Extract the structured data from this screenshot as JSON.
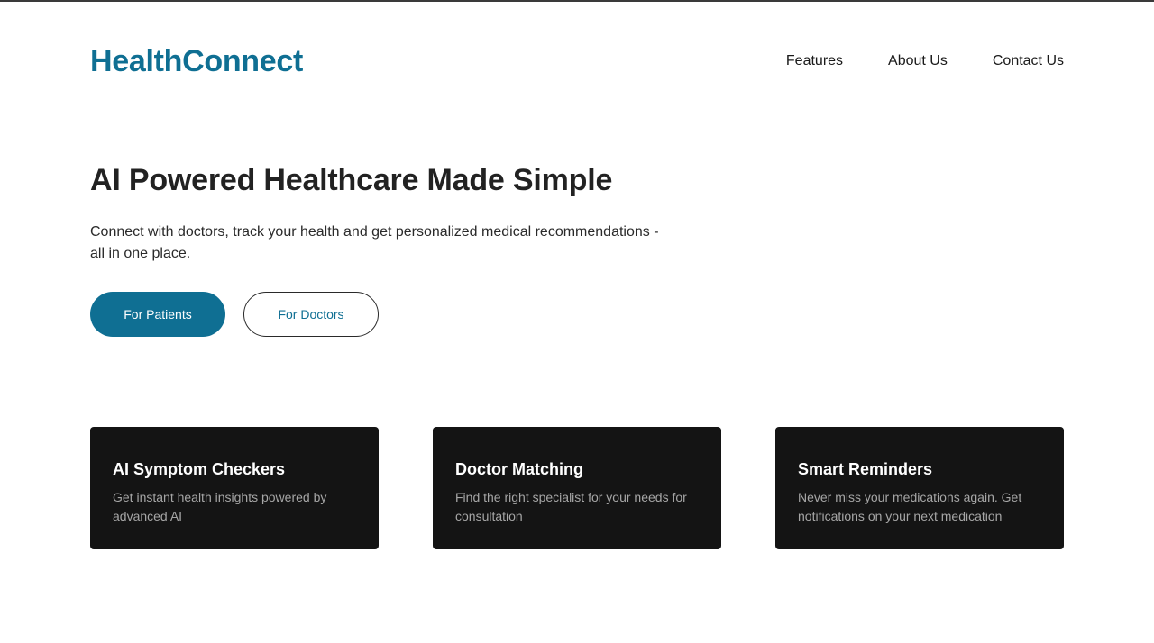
{
  "header": {
    "brand": "HealthConnect",
    "nav": [
      {
        "label": "Features"
      },
      {
        "label": "About Us"
      },
      {
        "label": "Contact Us"
      }
    ]
  },
  "hero": {
    "title": "AI Powered Healthcare Made Simple",
    "subtitle": "Connect with doctors, track your health and get personalized medical recommendations - all in one place.",
    "primary_button": "For Patients",
    "secondary_button": "For Doctors"
  },
  "features": [
    {
      "title": "AI Symptom Checkers",
      "description": "Get instant health insights powered by advanced AI"
    },
    {
      "title": "Doctor Matching",
      "description": "Find the right specialist for your needs for consultation"
    },
    {
      "title": "Smart Reminders",
      "description": "Never miss your medications again. Get notifications on your next medication"
    }
  ],
  "colors": {
    "brand": "#0f6f93",
    "card_background": "#141414",
    "card_text_muted": "#a6a6a6"
  }
}
